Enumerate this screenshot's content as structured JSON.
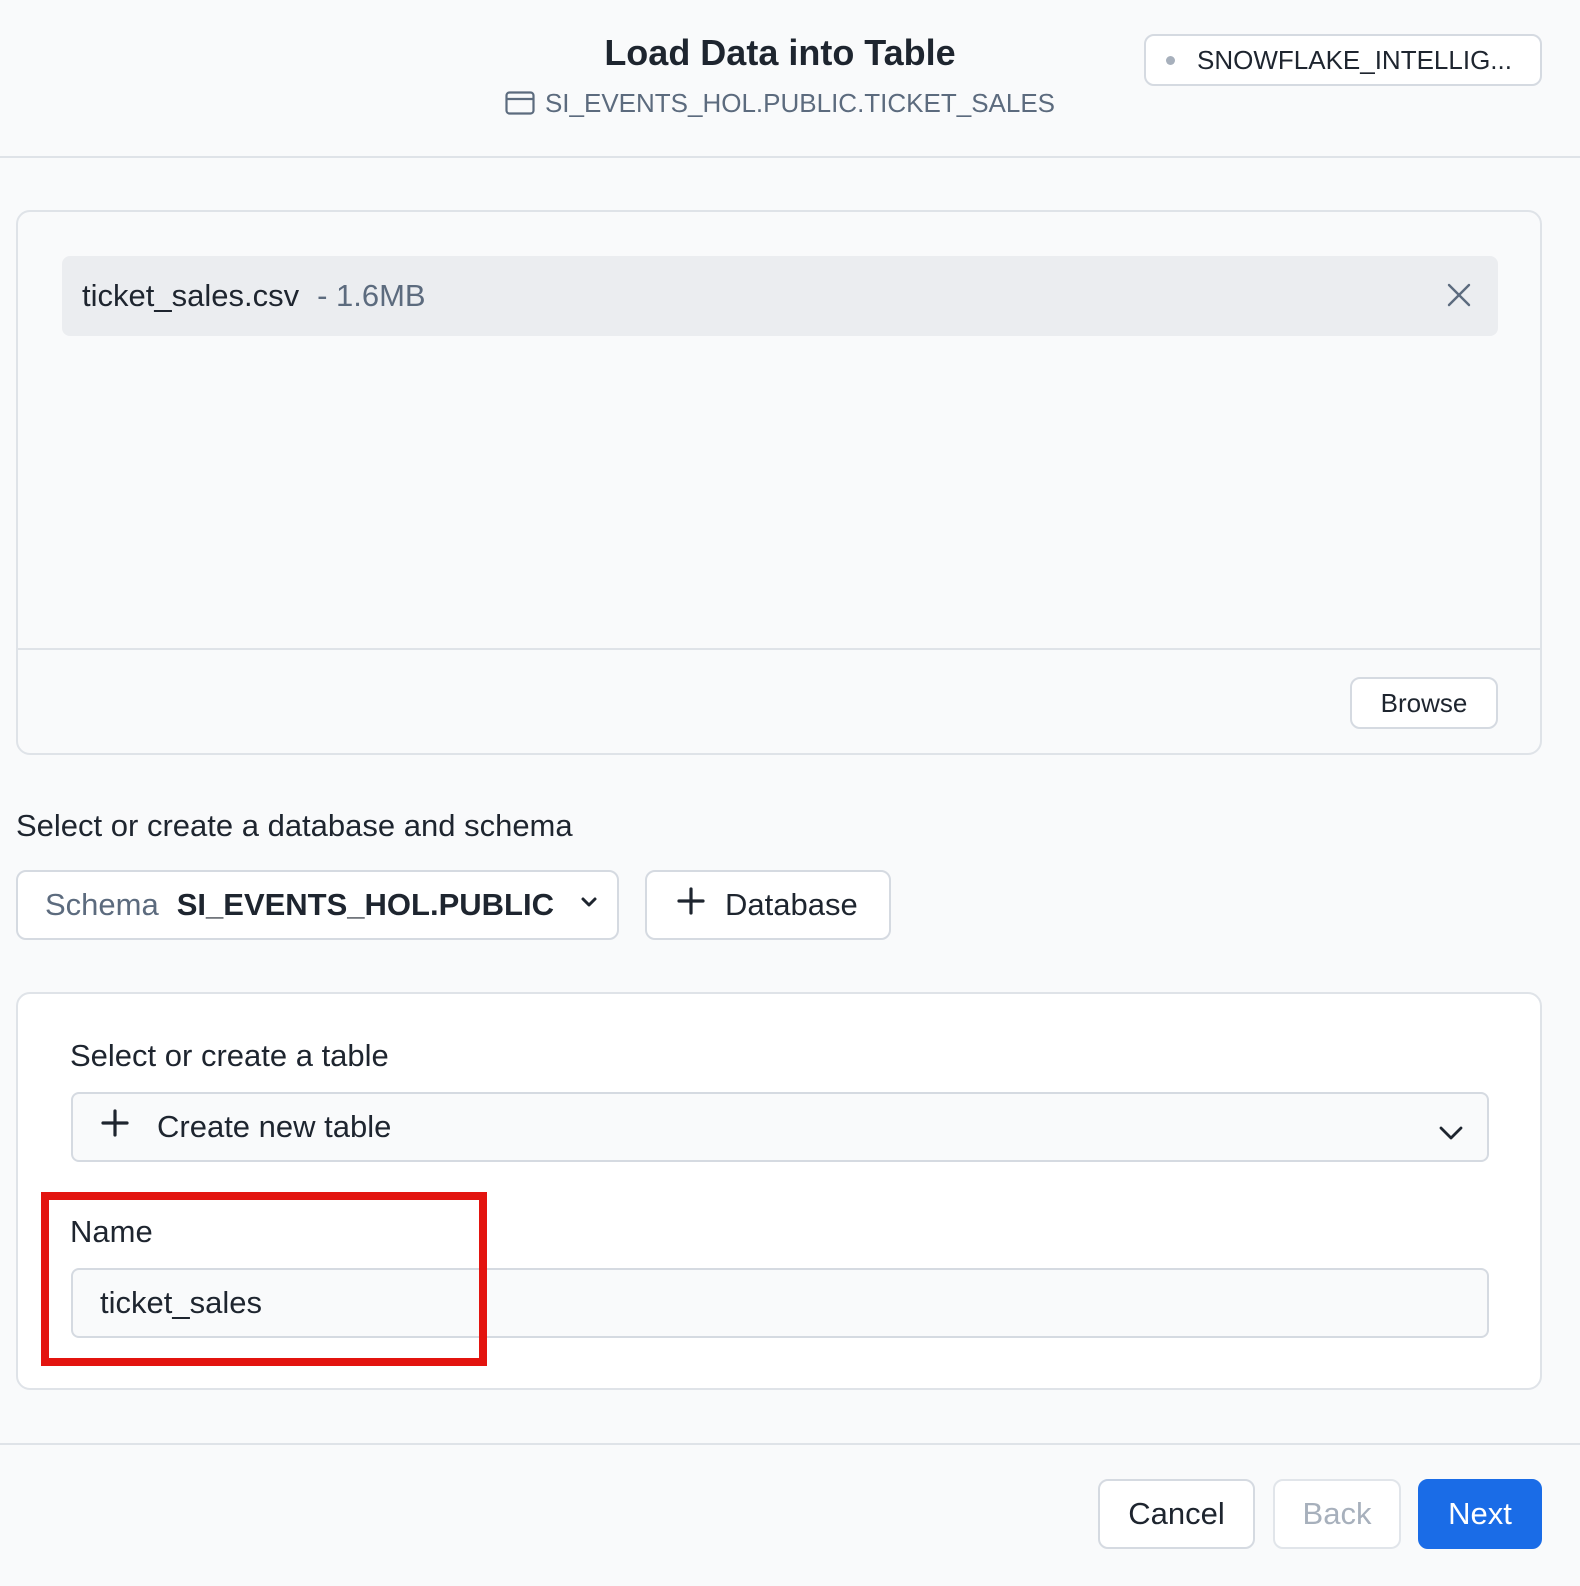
{
  "header": {
    "title": "Load Data into Table",
    "target_table": "SI_EVENTS_HOL.PUBLIC.TICKET_SALES",
    "warehouse": "SNOWFLAKE_INTELLIG...",
    "table_icon": "table-icon",
    "status_dot": "status-dot-icon"
  },
  "upload": {
    "file_name": "ticket_sales.csv",
    "file_size": "- 1.6MB",
    "remove_icon": "close-icon",
    "browse_label": "Browse"
  },
  "schema": {
    "section_label": "Select or create a database and schema",
    "select_key": "Schema",
    "select_value": "SI_EVENTS_HOL.PUBLIC",
    "add_database_label": "Database"
  },
  "table": {
    "section_label": "Select or create a table",
    "select_value": "Create new table",
    "name_label": "Name",
    "name_value": "ticket_sales"
  },
  "footer": {
    "cancel_label": "Cancel",
    "back_label": "Back",
    "next_label": "Next"
  },
  "colors": {
    "primary": "#1a6ce7",
    "highlight": "#e3140f",
    "text": "#1e252f",
    "muted_text": "#5c6b7e"
  }
}
